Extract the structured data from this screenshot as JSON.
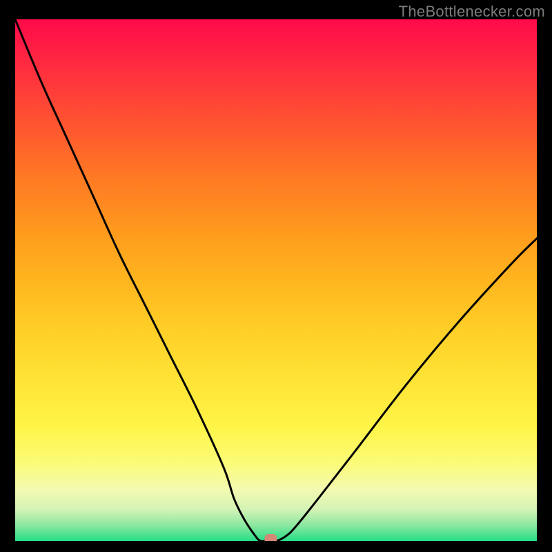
{
  "watermark": "TheBottlenecker.com",
  "chart_data": {
    "type": "line",
    "title": "",
    "xlabel": "",
    "ylabel": "",
    "xlim": [
      0,
      100
    ],
    "ylim": [
      0,
      100
    ],
    "series": [
      {
        "name": "bottleneck-curve",
        "x": [
          0,
          5,
          10,
          15,
          20,
          25,
          30,
          35,
          40,
          42,
          44,
          46,
          47,
          48,
          50,
          52,
          54,
          58,
          65,
          75,
          85,
          95,
          100
        ],
        "y": [
          100,
          88,
          77,
          66,
          55,
          45,
          35,
          25,
          14,
          8,
          4,
          1,
          0,
          0,
          0,
          1,
          3,
          8,
          17,
          30,
          42,
          53,
          58
        ]
      }
    ],
    "marker": {
      "x": 49,
      "y": 0,
      "color": "#d68876"
    },
    "gradient_bands": [
      {
        "y": 0.0,
        "color": "#ff0a4a"
      },
      {
        "y": 0.1,
        "color": "#ff2f3f"
      },
      {
        "y": 0.2,
        "color": "#ff5430"
      },
      {
        "y": 0.3,
        "color": "#ff7824"
      },
      {
        "y": 0.4,
        "color": "#ff981d"
      },
      {
        "y": 0.5,
        "color": "#ffb51e"
      },
      {
        "y": 0.6,
        "color": "#ffd028"
      },
      {
        "y": 0.7,
        "color": "#ffe537"
      },
      {
        "y": 0.78,
        "color": "#fff547"
      },
      {
        "y": 0.85,
        "color": "#fbfb77"
      },
      {
        "y": 0.9,
        "color": "#f4fab0"
      },
      {
        "y": 0.94,
        "color": "#d3f3b6"
      },
      {
        "y": 0.97,
        "color": "#8be8a0"
      },
      {
        "y": 1.0,
        "color": "#27dd87"
      }
    ]
  }
}
